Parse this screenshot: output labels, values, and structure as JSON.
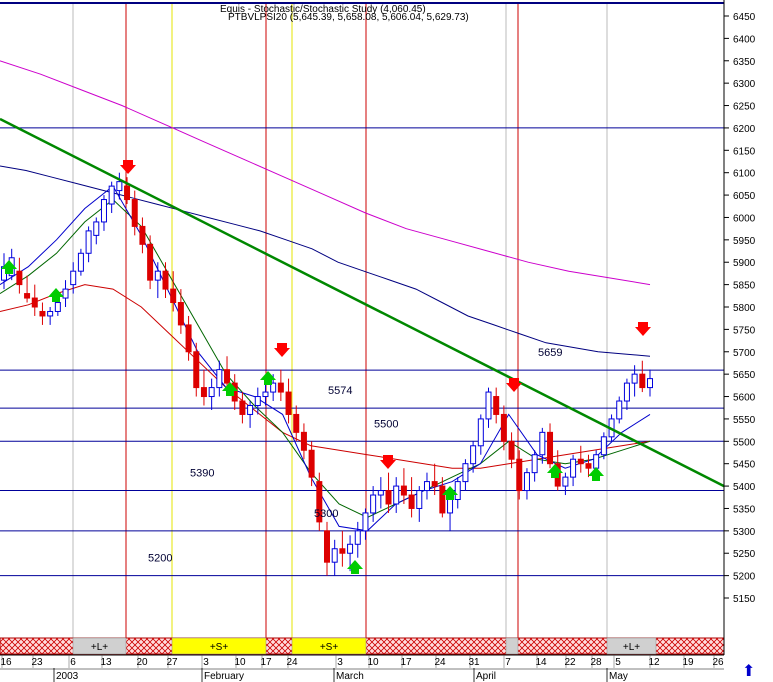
{
  "chart_data": {
    "type": "candlestick",
    "title": "Equis - Stochastic/Stochastic Study (4,060.45)",
    "subtitle": "PTBVLPSI20 (5,645.39, 5,658.08, 5,606.04, 5,629.73)",
    "ylim": [
      5100,
      6475
    ],
    "y_ticks": [
      6450,
      6400,
      6350,
      6300,
      6250,
      6200,
      6150,
      6100,
      6050,
      6000,
      5950,
      5900,
      5850,
      5800,
      5750,
      5700,
      5650,
      5600,
      5550,
      5500,
      5450,
      5400,
      5350,
      5300,
      5250,
      5200,
      5150
    ],
    "x_ticks": [
      "16",
      "23",
      "6",
      "13",
      "20",
      "27",
      "3",
      "10",
      "17",
      "24",
      "3",
      "10",
      "17",
      "24",
      "31",
      "7",
      "14",
      "22",
      "28",
      "5",
      "12",
      "19",
      "26"
    ],
    "months": [
      "2003",
      "February",
      "March",
      "April",
      "May"
    ],
    "horizontal_levels": [
      6200,
      5659,
      5574,
      5500,
      5390,
      5300,
      5200
    ],
    "level_labels": [
      {
        "text": "5659",
        "value": 5659
      },
      {
        "text": "5574",
        "value": 5574
      },
      {
        "text": "5500",
        "value": 5500
      },
      {
        "text": "5390",
        "value": 5390
      },
      {
        "text": "5300",
        "value": 5300
      },
      {
        "text": "5200",
        "value": 5200
      }
    ],
    "bottom_bar_labels": [
      "+L+",
      "+S+",
      "+S+",
      "+L+"
    ],
    "trendline": {
      "from": 6220,
      "to": 5400
    },
    "candles": [
      [
        5860,
        5920,
        5840,
        5890
      ],
      [
        5870,
        5930,
        5860,
        5910
      ],
      [
        5880,
        5910,
        5830,
        5850
      ],
      [
        5830,
        5870,
        5810,
        5820
      ],
      [
        5820,
        5850,
        5780,
        5800
      ],
      [
        5790,
        5810,
        5760,
        5780
      ],
      [
        5780,
        5800,
        5760,
        5790
      ],
      [
        5790,
        5830,
        5780,
        5810
      ],
      [
        5820,
        5860,
        5800,
        5840
      ],
      [
        5850,
        5900,
        5830,
        5880
      ],
      [
        5880,
        5930,
        5870,
        5920
      ],
      [
        5920,
        5980,
        5900,
        5970
      ],
      [
        5960,
        6000,
        5940,
        5990
      ],
      [
        5990,
        6050,
        5970,
        6040
      ],
      [
        6030,
        6080,
        6010,
        6070
      ],
      [
        6060,
        6100,
        6040,
        6080
      ],
      [
        6070,
        6090,
        6030,
        6040
      ],
      [
        6040,
        6060,
        5960,
        5980
      ],
      [
        5980,
        6000,
        5920,
        5940
      ],
      [
        5940,
        5960,
        5840,
        5860
      ],
      [
        5860,
        5900,
        5820,
        5880
      ],
      [
        5880,
        5900,
        5820,
        5840
      ],
      [
        5840,
        5880,
        5790,
        5810
      ],
      [
        5810,
        5840,
        5740,
        5760
      ],
      [
        5760,
        5780,
        5680,
        5700
      ],
      [
        5700,
        5720,
        5600,
        5620
      ],
      [
        5620,
        5660,
        5580,
        5600
      ],
      [
        5600,
        5640,
        5570,
        5620
      ],
      [
        5620,
        5680,
        5600,
        5660
      ],
      [
        5660,
        5690,
        5610,
        5630
      ],
      [
        5630,
        5650,
        5570,
        5590
      ],
      [
        5590,
        5610,
        5540,
        5560
      ],
      [
        5560,
        5590,
        5530,
        5580
      ],
      [
        5580,
        5620,
        5560,
        5600
      ],
      [
        5600,
        5640,
        5580,
        5610
      ],
      [
        5610,
        5650,
        5590,
        5630
      ],
      [
        5630,
        5660,
        5590,
        5610
      ],
      [
        5610,
        5640,
        5540,
        5560
      ],
      [
        5560,
        5580,
        5500,
        5520
      ],
      [
        5520,
        5540,
        5460,
        5480
      ],
      [
        5480,
        5500,
        5400,
        5420
      ],
      [
        5410,
        5430,
        5300,
        5320
      ],
      [
        5300,
        5320,
        5200,
        5230
      ],
      [
        5230,
        5280,
        5200,
        5260
      ],
      [
        5260,
        5300,
        5220,
        5250
      ],
      [
        5250,
        5290,
        5210,
        5270
      ],
      [
        5270,
        5320,
        5240,
        5300
      ],
      [
        5300,
        5350,
        5280,
        5340
      ],
      [
        5340,
        5400,
        5320,
        5380
      ],
      [
        5380,
        5420,
        5350,
        5390
      ],
      [
        5390,
        5430,
        5340,
        5360
      ],
      [
        5360,
        5420,
        5340,
        5400
      ],
      [
        5400,
        5440,
        5360,
        5380
      ],
      [
        5380,
        5420,
        5330,
        5350
      ],
      [
        5350,
        5400,
        5320,
        5390
      ],
      [
        5390,
        5430,
        5370,
        5410
      ],
      [
        5410,
        5450,
        5380,
        5400
      ],
      [
        5400,
        5420,
        5330,
        5340
      ],
      [
        5340,
        5380,
        5300,
        5370
      ],
      [
        5370,
        5420,
        5350,
        5410
      ],
      [
        5410,
        5460,
        5390,
        5450
      ],
      [
        5450,
        5500,
        5430,
        5490
      ],
      [
        5490,
        5560,
        5470,
        5550
      ],
      [
        5550,
        5620,
        5530,
        5610
      ],
      [
        5600,
        5620,
        5540,
        5560
      ],
      [
        5560,
        5580,
        5480,
        5500
      ],
      [
        5500,
        5520,
        5440,
        5460
      ],
      [
        5460,
        5480,
        5370,
        5390
      ],
      [
        5390,
        5440,
        5370,
        5430
      ],
      [
        5430,
        5480,
        5410,
        5470
      ],
      [
        5470,
        5530,
        5450,
        5520
      ],
      [
        5520,
        5540,
        5440,
        5450
      ],
      [
        5450,
        5480,
        5390,
        5400
      ],
      [
        5400,
        5430,
        5380,
        5420
      ],
      [
        5420,
        5470,
        5400,
        5460
      ],
      [
        5460,
        5490,
        5430,
        5450
      ],
      [
        5450,
        5470,
        5420,
        5440
      ],
      [
        5440,
        5480,
        5430,
        5470
      ],
      [
        5470,
        5520,
        5460,
        5510
      ],
      [
        5510,
        5560,
        5500,
        5550
      ],
      [
        5550,
        5600,
        5540,
        5590
      ],
      [
        5590,
        5640,
        5570,
        5630
      ],
      [
        5630,
        5670,
        5600,
        5650
      ],
      [
        5650,
        5680,
        5610,
        5620
      ],
      [
        5620,
        5660,
        5600,
        5640
      ]
    ],
    "series": [
      {
        "name": "",
        "color": "#000080",
        "values": [
          6115,
          6105,
          6090,
          6075,
          6060,
          6045,
          6030,
          6015,
          6000,
          5985,
          5970,
          5950,
          5930,
          5900,
          5880,
          5860,
          5840,
          5810,
          5780,
          5760,
          5740,
          5720,
          5710,
          5700,
          5695,
          5690
        ]
      },
      {
        "name": "",
        "color": "#cc00cc",
        "values": [
          6350,
          6320,
          6285,
          6250,
          6210,
          6170,
          6130,
          6090,
          6050,
          6010,
          5975,
          5950,
          5925,
          5900,
          5880,
          5865,
          5850
        ]
      },
      {
        "name": "",
        "color": "#cc0000",
        "values": [
          5790,
          5805,
          5830,
          5850,
          5840,
          5800,
          5740,
          5680,
          5620,
          5570,
          5520,
          5490,
          5480,
          5470,
          5460,
          5450,
          5440,
          5440,
          5450,
          5460,
          5470,
          5480,
          5490,
          5500
        ]
      },
      {
        "name": "",
        "color": "#006600",
        "values": [
          5830,
          5870,
          5920,
          5990,
          6040,
          5980,
          5870,
          5760,
          5650,
          5580,
          5520,
          5430,
          5360,
          5330,
          5360,
          5390,
          5420,
          5450,
          5500,
          5460,
          5450,
          5460,
          5480,
          5500
        ]
      },
      {
        "name": "",
        "color": "#0000cc",
        "values": [
          5850,
          5890,
          5950,
          6020,
          6070,
          5960,
          5830,
          5700,
          5620,
          5600,
          5560,
          5420,
          5310,
          5300,
          5360,
          5390,
          5410,
          5450,
          5560,
          5470,
          5440,
          5460,
          5520,
          5560
        ]
      }
    ]
  }
}
